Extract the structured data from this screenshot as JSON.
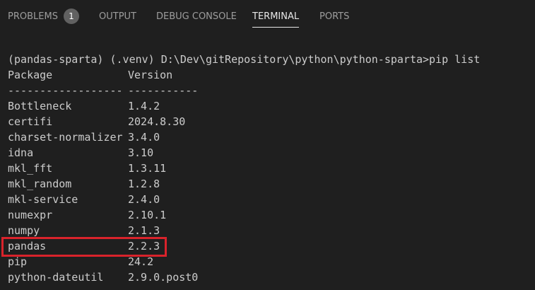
{
  "tabs": [
    {
      "label": "PROBLEMS",
      "active": false
    },
    {
      "label": "OUTPUT",
      "active": false
    },
    {
      "label": "DEBUG CONSOLE",
      "active": false
    },
    {
      "label": "TERMINAL",
      "active": true
    },
    {
      "label": "PORTS",
      "active": false
    }
  ],
  "problems_badge": "1",
  "terminal": {
    "prompt_line": "(pandas-sparta) (.venv) D:\\Dev\\gitRepository\\python\\python-sparta>pip list",
    "header": {
      "package": "Package",
      "version": "Version"
    },
    "separator": {
      "package": "------------------",
      "version": "-----------"
    },
    "packages": [
      {
        "name": "Bottleneck",
        "version": "1.4.2"
      },
      {
        "name": "certifi",
        "version": "2024.8.30"
      },
      {
        "name": "charset-normalizer",
        "version": "3.4.0"
      },
      {
        "name": "idna",
        "version": "3.10"
      },
      {
        "name": "mkl_fft",
        "version": "1.3.11"
      },
      {
        "name": "mkl_random",
        "version": "1.2.8"
      },
      {
        "name": "mkl-service",
        "version": "2.4.0"
      },
      {
        "name": "numexpr",
        "version": "2.10.1"
      },
      {
        "name": "numpy",
        "version": "2.1.3"
      },
      {
        "name": "pandas",
        "version": "2.2.3"
      },
      {
        "name": "pip",
        "version": "24.2"
      },
      {
        "name": "python-dateutil",
        "version": "2.9.0.post0"
      }
    ]
  },
  "colors": {
    "background": "#1f1f1f",
    "text": "#cccccc",
    "highlight_border": "#d9232b"
  }
}
